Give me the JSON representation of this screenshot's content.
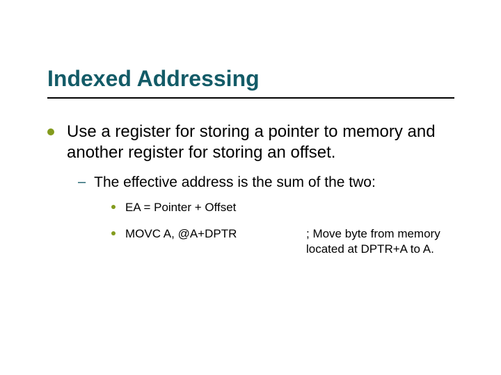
{
  "title": "Indexed Addressing",
  "bullets": {
    "main": "Use a register for storing a pointer to memory and another register for storing an offset.",
    "sub1": "The effective address is the sum of the two:",
    "code1": "EA = Pointer + Offset",
    "code2_left": "MOVC A, @A+DPTR",
    "code2_right": "; Move byte from memory located at DPTR+A to A."
  }
}
